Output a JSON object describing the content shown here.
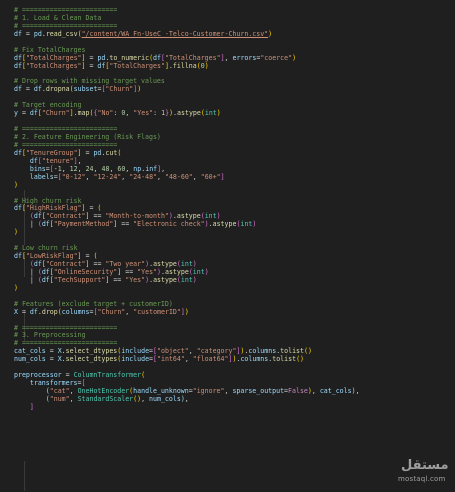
{
  "code_lines": [
    [
      [
        "c",
        "# ========================"
      ]
    ],
    [
      [
        "c",
        "# 1. Load & Clean Data"
      ]
    ],
    [
      [
        "c",
        "# ========================"
      ]
    ],
    [
      [
        "v",
        "df"
      ],
      [
        "o",
        " = "
      ],
      [
        "v",
        "pd"
      ],
      [
        "o",
        "."
      ],
      [
        "f",
        "read_csv"
      ],
      [
        "b",
        "("
      ],
      [
        "su",
        "\"/content/WA_Fn-UseC_-Telco-Customer-Churn.csv\""
      ],
      [
        "b",
        ")"
      ]
    ],
    [],
    [
      [
        "c",
        "# Fix TotalCharges"
      ]
    ],
    [
      [
        "v",
        "df"
      ],
      [
        "b",
        "["
      ],
      [
        "s",
        "\"TotalCharges\""
      ],
      [
        "b",
        "]"
      ],
      [
        "o",
        " = "
      ],
      [
        "v",
        "pd"
      ],
      [
        "o",
        "."
      ],
      [
        "f",
        "to_numeric"
      ],
      [
        "b",
        "("
      ],
      [
        "v",
        "df"
      ],
      [
        "p",
        "["
      ],
      [
        "s",
        "\"TotalCharges\""
      ],
      [
        "p",
        "]"
      ],
      [
        "o",
        ", "
      ],
      [
        "v",
        "errors"
      ],
      [
        "o",
        "="
      ],
      [
        "s",
        "\"coerce\""
      ],
      [
        "b",
        ")"
      ]
    ],
    [
      [
        "v",
        "df"
      ],
      [
        "b",
        "["
      ],
      [
        "s",
        "\"TotalCharges\""
      ],
      [
        "b",
        "]"
      ],
      [
        "o",
        " = "
      ],
      [
        "v",
        "df"
      ],
      [
        "b",
        "["
      ],
      [
        "s",
        "\"TotalCharges\""
      ],
      [
        "b",
        "]"
      ],
      [
        "o",
        "."
      ],
      [
        "f",
        "fillna"
      ],
      [
        "b",
        "("
      ],
      [
        "n",
        "0"
      ],
      [
        "b",
        ")"
      ]
    ],
    [],
    [
      [
        "c",
        "# Drop rows with missing target values"
      ]
    ],
    [
      [
        "v",
        "df"
      ],
      [
        "o",
        " = "
      ],
      [
        "v",
        "df"
      ],
      [
        "o",
        "."
      ],
      [
        "f",
        "dropna"
      ],
      [
        "b",
        "("
      ],
      [
        "v",
        "subset"
      ],
      [
        "o",
        "="
      ],
      [
        "p",
        "["
      ],
      [
        "s",
        "\"Churn\""
      ],
      [
        "p",
        "]"
      ],
      [
        "b",
        ")"
      ]
    ],
    [],
    [
      [
        "c",
        "# Target encoding"
      ]
    ],
    [
      [
        "v",
        "y"
      ],
      [
        "o",
        " = "
      ],
      [
        "v",
        "df"
      ],
      [
        "b",
        "["
      ],
      [
        "s",
        "\"Churn\""
      ],
      [
        "b",
        "]"
      ],
      [
        "o",
        "."
      ],
      [
        "f",
        "map"
      ],
      [
        "b",
        "("
      ],
      [
        "p",
        "{"
      ],
      [
        "s",
        "\"No\""
      ],
      [
        "o",
        ": "
      ],
      [
        "n",
        "0"
      ],
      [
        "o",
        ", "
      ],
      [
        "s",
        "\"Yes\""
      ],
      [
        "o",
        ": "
      ],
      [
        "n",
        "1"
      ],
      [
        "p",
        "}"
      ],
      [
        "b",
        ")"
      ],
      [
        "o",
        "."
      ],
      [
        "f",
        "astype"
      ],
      [
        "b",
        "("
      ],
      [
        "t",
        "int"
      ],
      [
        "b",
        ")"
      ]
    ],
    [],
    [
      [
        "c",
        "# ========================"
      ]
    ],
    [
      [
        "c",
        "# 2. Feature Engineering (Risk Flags)"
      ]
    ],
    [
      [
        "c",
        "# ========================"
      ]
    ],
    [
      [
        "v",
        "df"
      ],
      [
        "b",
        "["
      ],
      [
        "s",
        "\"TenureGroup\""
      ],
      [
        "b",
        "]"
      ],
      [
        "o",
        " = "
      ],
      [
        "v",
        "pd"
      ],
      [
        "o",
        "."
      ],
      [
        "f",
        "cut"
      ],
      [
        "b",
        "("
      ]
    ],
    [
      [
        "o",
        "    "
      ],
      [
        "v",
        "df"
      ],
      [
        "p",
        "["
      ],
      [
        "s",
        "\"tenure\""
      ],
      [
        "p",
        "]"
      ],
      [
        "o",
        ","
      ]
    ],
    [
      [
        "o",
        "    "
      ],
      [
        "v",
        "bins"
      ],
      [
        "o",
        "="
      ],
      [
        "p",
        "["
      ],
      [
        "o",
        "-"
      ],
      [
        "n",
        "1"
      ],
      [
        "o",
        ", "
      ],
      [
        "n",
        "12"
      ],
      [
        "o",
        ", "
      ],
      [
        "n",
        "24"
      ],
      [
        "o",
        ", "
      ],
      [
        "n",
        "48"
      ],
      [
        "o",
        ", "
      ],
      [
        "n",
        "60"
      ],
      [
        "o",
        ", "
      ],
      [
        "v",
        "np"
      ],
      [
        "o",
        "."
      ],
      [
        "v",
        "inf"
      ],
      [
        "p",
        "]"
      ],
      [
        "o",
        ","
      ]
    ],
    [
      [
        "o",
        "    "
      ],
      [
        "v",
        "labels"
      ],
      [
        "o",
        "="
      ],
      [
        "p",
        "["
      ],
      [
        "s",
        "\"0-12\""
      ],
      [
        "o",
        ", "
      ],
      [
        "s",
        "\"12-24\""
      ],
      [
        "o",
        ", "
      ],
      [
        "s",
        "\"24-48\""
      ],
      [
        "o",
        ", "
      ],
      [
        "s",
        "\"48-60\""
      ],
      [
        "o",
        ", "
      ],
      [
        "s",
        "\"60+\""
      ],
      [
        "p",
        "]"
      ]
    ],
    [
      [
        "b",
        ")"
      ]
    ],
    [],
    [
      [
        "c",
        "# High churn risk"
      ]
    ],
    [
      [
        "v",
        "df"
      ],
      [
        "b",
        "["
      ],
      [
        "s",
        "\"HighRiskFlag\""
      ],
      [
        "b",
        "]"
      ],
      [
        "o",
        " = "
      ],
      [
        "b",
        "("
      ]
    ],
    [
      [
        "o",
        "    "
      ],
      [
        "p",
        "("
      ],
      [
        "v",
        "df"
      ],
      [
        "o",
        "["
      ],
      [
        "s",
        "\"Contract\""
      ],
      [
        "o",
        "]"
      ],
      [
        "o",
        " == "
      ],
      [
        "s",
        "\"Month-to-month\""
      ],
      [
        "p",
        ")"
      ],
      [
        "o",
        "."
      ],
      [
        "f",
        "astype"
      ],
      [
        "p",
        "("
      ],
      [
        "t",
        "int"
      ],
      [
        "p",
        ")"
      ]
    ],
    [
      [
        "o",
        "    | "
      ],
      [
        "p",
        "("
      ],
      [
        "v",
        "df"
      ],
      [
        "o",
        "["
      ],
      [
        "s",
        "\"PaymentMethod\""
      ],
      [
        "o",
        "]"
      ],
      [
        "o",
        " == "
      ],
      [
        "s",
        "\"Electronic check\""
      ],
      [
        "p",
        ")"
      ],
      [
        "o",
        "."
      ],
      [
        "f",
        "astype"
      ],
      [
        "p",
        "("
      ],
      [
        "t",
        "int"
      ],
      [
        "p",
        ")"
      ]
    ],
    [
      [
        "b",
        ")"
      ]
    ],
    [],
    [
      [
        "c",
        "# Low churn risk"
      ]
    ],
    [
      [
        "v",
        "df"
      ],
      [
        "b",
        "["
      ],
      [
        "s",
        "\"LowRiskFlag\""
      ],
      [
        "b",
        "]"
      ],
      [
        "o",
        " = "
      ],
      [
        "b",
        "("
      ]
    ],
    [
      [
        "o",
        "    "
      ],
      [
        "p",
        "("
      ],
      [
        "v",
        "df"
      ],
      [
        "o",
        "["
      ],
      [
        "s",
        "\"Contract\""
      ],
      [
        "o",
        "]"
      ],
      [
        "o",
        " == "
      ],
      [
        "s",
        "\"Two year\""
      ],
      [
        "p",
        ")"
      ],
      [
        "o",
        "."
      ],
      [
        "f",
        "astype"
      ],
      [
        "p",
        "("
      ],
      [
        "t",
        "int"
      ],
      [
        "p",
        ")"
      ]
    ],
    [
      [
        "o",
        "    | "
      ],
      [
        "p",
        "("
      ],
      [
        "v",
        "df"
      ],
      [
        "o",
        "["
      ],
      [
        "s",
        "\"OnlineSecurity\""
      ],
      [
        "o",
        "]"
      ],
      [
        "o",
        " == "
      ],
      [
        "s",
        "\"Yes\""
      ],
      [
        "p",
        ")"
      ],
      [
        "o",
        "."
      ],
      [
        "f",
        "astype"
      ],
      [
        "p",
        "("
      ],
      [
        "t",
        "int"
      ],
      [
        "p",
        ")"
      ]
    ],
    [
      [
        "o",
        "    | "
      ],
      [
        "p",
        "("
      ],
      [
        "v",
        "df"
      ],
      [
        "o",
        "["
      ],
      [
        "s",
        "\"TechSupport\""
      ],
      [
        "o",
        "]"
      ],
      [
        "o",
        " == "
      ],
      [
        "s",
        "\"Yes\""
      ],
      [
        "p",
        ")"
      ],
      [
        "o",
        "."
      ],
      [
        "f",
        "astype"
      ],
      [
        "p",
        "("
      ],
      [
        "t",
        "int"
      ],
      [
        "p",
        ")"
      ]
    ],
    [
      [
        "b",
        ")"
      ]
    ],
    [],
    [
      [
        "c",
        "# Features (exclude target + customerID)"
      ]
    ],
    [
      [
        "v",
        "X"
      ],
      [
        "o",
        " = "
      ],
      [
        "v",
        "df"
      ],
      [
        "o",
        "."
      ],
      [
        "f",
        "drop"
      ],
      [
        "b",
        "("
      ],
      [
        "v",
        "columns"
      ],
      [
        "o",
        "="
      ],
      [
        "p",
        "["
      ],
      [
        "s",
        "\"Churn\""
      ],
      [
        "o",
        ", "
      ],
      [
        "s",
        "\"customerID\""
      ],
      [
        "p",
        "]"
      ],
      [
        "b",
        ")"
      ]
    ],
    [],
    [
      [
        "c",
        "# ========================"
      ]
    ],
    [
      [
        "c",
        "# 3. Preprocessing"
      ]
    ],
    [
      [
        "c",
        "# ========================"
      ]
    ],
    [
      [
        "v",
        "cat_cols"
      ],
      [
        "o",
        " = "
      ],
      [
        "v",
        "X"
      ],
      [
        "o",
        "."
      ],
      [
        "f",
        "select_dtypes"
      ],
      [
        "b",
        "("
      ],
      [
        "v",
        "include"
      ],
      [
        "o",
        "="
      ],
      [
        "p",
        "["
      ],
      [
        "s",
        "\"object\""
      ],
      [
        "o",
        ", "
      ],
      [
        "s",
        "\"category\""
      ],
      [
        "p",
        "]"
      ],
      [
        "b",
        ")"
      ],
      [
        "o",
        "."
      ],
      [
        "v",
        "columns"
      ],
      [
        "o",
        "."
      ],
      [
        "f",
        "tolist"
      ],
      [
        "b",
        "()"
      ]
    ],
    [
      [
        "v",
        "num_cols"
      ],
      [
        "o",
        " = "
      ],
      [
        "v",
        "X"
      ],
      [
        "o",
        "."
      ],
      [
        "f",
        "select_dtypes"
      ],
      [
        "b",
        "("
      ],
      [
        "v",
        "include"
      ],
      [
        "o",
        "="
      ],
      [
        "p",
        "["
      ],
      [
        "s",
        "\"int64\""
      ],
      [
        "o",
        ", "
      ],
      [
        "s",
        "\"float64\""
      ],
      [
        "p",
        "]"
      ],
      [
        "b",
        ")"
      ],
      [
        "o",
        "."
      ],
      [
        "v",
        "columns"
      ],
      [
        "o",
        "."
      ],
      [
        "f",
        "tolist"
      ],
      [
        "b",
        "()"
      ]
    ],
    [],
    [
      [
        "v",
        "preprocessor"
      ],
      [
        "o",
        " = "
      ],
      [
        "t",
        "ColumnTransformer"
      ],
      [
        "b",
        "("
      ]
    ],
    [
      [
        "o",
        "    "
      ],
      [
        "v",
        "transformers"
      ],
      [
        "o",
        "="
      ],
      [
        "p",
        "["
      ]
    ],
    [
      [
        "o",
        "        "
      ],
      [
        "v",
        "("
      ],
      [
        "s",
        "\"cat\""
      ],
      [
        "o",
        ", "
      ],
      [
        "t",
        "OneHotEncoder"
      ],
      [
        "b",
        "("
      ],
      [
        "v",
        "handle_unknown"
      ],
      [
        "o",
        "="
      ],
      [
        "s",
        "\"ignore\""
      ],
      [
        "o",
        ", "
      ],
      [
        "v",
        "sparse_output"
      ],
      [
        "o",
        "="
      ],
      [
        "k",
        "False"
      ],
      [
        "b",
        ")"
      ],
      [
        "o",
        ", "
      ],
      [
        "v",
        "cat_cols"
      ],
      [
        "v",
        ")"
      ],
      [
        "o",
        ","
      ]
    ],
    [
      [
        "o",
        "        "
      ],
      [
        "v",
        "("
      ],
      [
        "s",
        "\"num\""
      ],
      [
        "o",
        ", "
      ],
      [
        "t",
        "StandardScaler"
      ],
      [
        "b",
        "()"
      ],
      [
        "o",
        ", "
      ],
      [
        "v",
        "num_cols"
      ],
      [
        "v",
        ")"
      ],
      [
        "o",
        ","
      ]
    ],
    [
      [
        "o",
        "    "
      ],
      [
        "p",
        "]"
      ]
    ]
  ],
  "watermark": {
    "logo": "مستقل",
    "text": "mostaql.com"
  }
}
